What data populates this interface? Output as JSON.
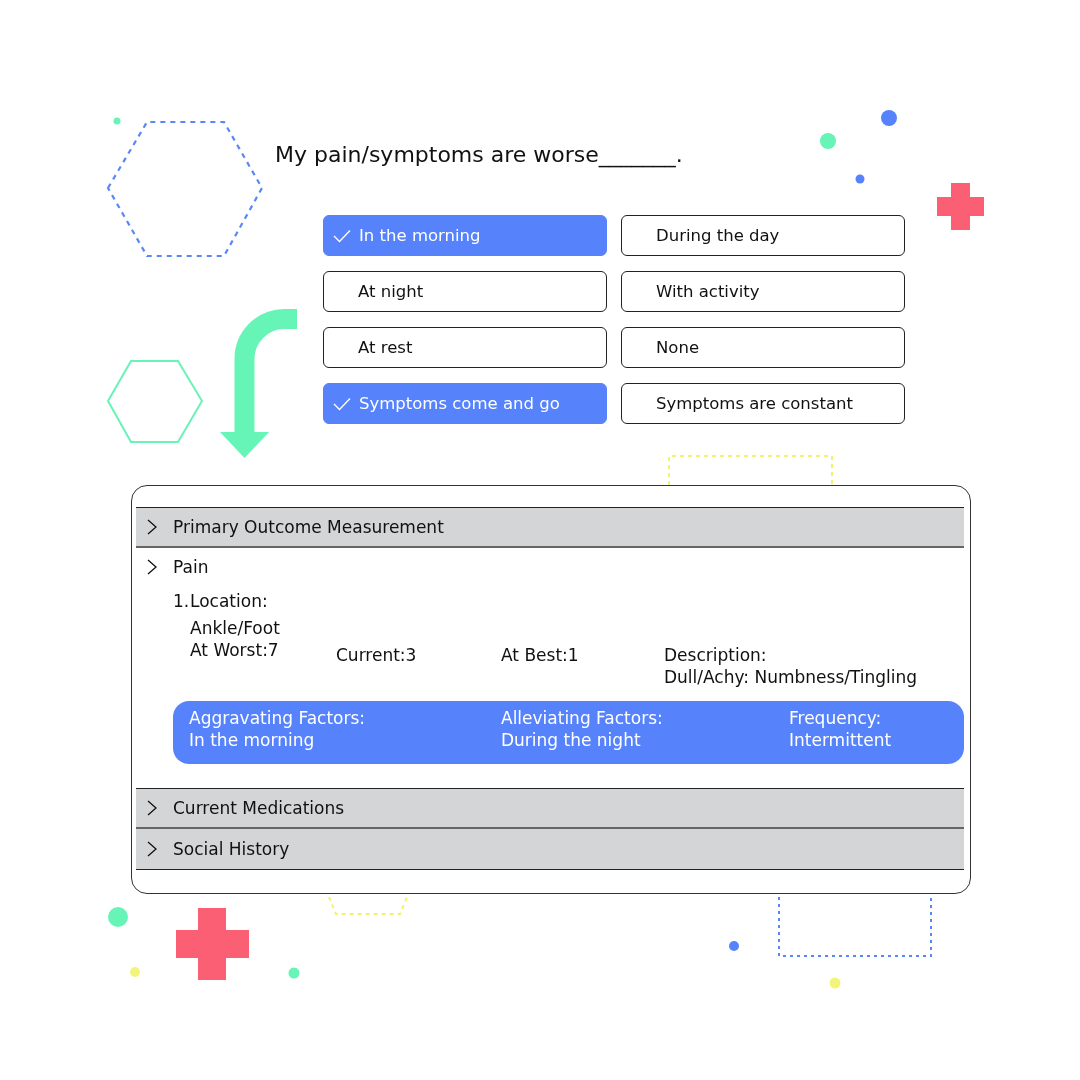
{
  "question": "My pain/symptoms are worse_______.",
  "options": [
    {
      "label": "In the morning",
      "selected": true
    },
    {
      "label": "During the day",
      "selected": false
    },
    {
      "label": "At night",
      "selected": false
    },
    {
      "label": "With activity",
      "selected": false
    },
    {
      "label": "At rest",
      "selected": false
    },
    {
      "label": "None",
      "selected": false
    },
    {
      "label": "Symptoms come and go",
      "selected": true
    },
    {
      "label": "Symptoms are constant",
      "selected": false
    }
  ],
  "record": {
    "sections": [
      {
        "kind": "bar",
        "title": "Primary Outcome Measurement"
      },
      {
        "kind": "open",
        "title": "Pain",
        "detail": {
          "number": "1.",
          "label": "Location:",
          "location": "Ankle/Foot",
          "ratings": [
            "At Worst:7",
            "Current:3",
            "At Best:1"
          ],
          "description_label": "Description:",
          "description": "Dull/Achy: Numbness/Tingling",
          "factors": [
            {
              "label": "Aggravating Factors:",
              "value": "In the morning"
            },
            {
              "label": "Alleviating Factors:",
              "value": "During the night"
            },
            {
              "label": "Frequency:",
              "value": "Intermittent"
            }
          ]
        }
      },
      {
        "kind": "bar",
        "title": "Current Medications"
      },
      {
        "kind": "bar",
        "title": "Social History"
      }
    ]
  }
}
